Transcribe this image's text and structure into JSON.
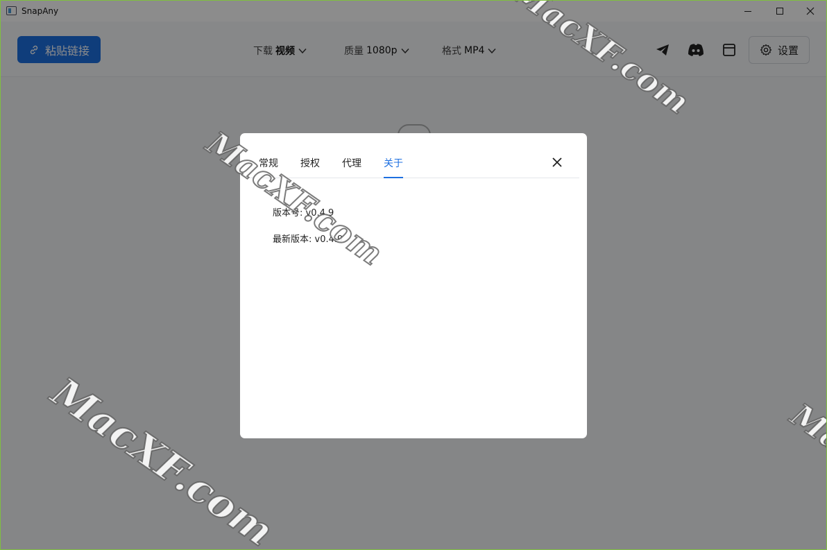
{
  "window": {
    "title": "SnapAny"
  },
  "toolbar": {
    "paste_label": "粘贴链接",
    "download": {
      "label": "下载",
      "value": "视频"
    },
    "quality": {
      "label": "质量",
      "value": "1080p"
    },
    "format": {
      "label": "格式",
      "value": "MP4"
    },
    "icons": [
      "telegram-icon",
      "discord-icon",
      "window-icon",
      "gear-icon"
    ],
    "settings_label": "设置"
  },
  "settings_modal": {
    "tabs": [
      {
        "label": "常规",
        "active": false
      },
      {
        "label": "授权",
        "active": false
      },
      {
        "label": "代理",
        "active": false
      },
      {
        "label": "关于",
        "active": true
      }
    ],
    "about": {
      "version_label": "版本号:",
      "version_value": "v0.4.9",
      "latest_label": "最新版本:",
      "latest_value": "v0.4.9"
    }
  },
  "watermark": "MacXF.com",
  "colors": {
    "accent": "#1d6fe0",
    "overlay": "rgba(0,0,0,0.45)"
  }
}
